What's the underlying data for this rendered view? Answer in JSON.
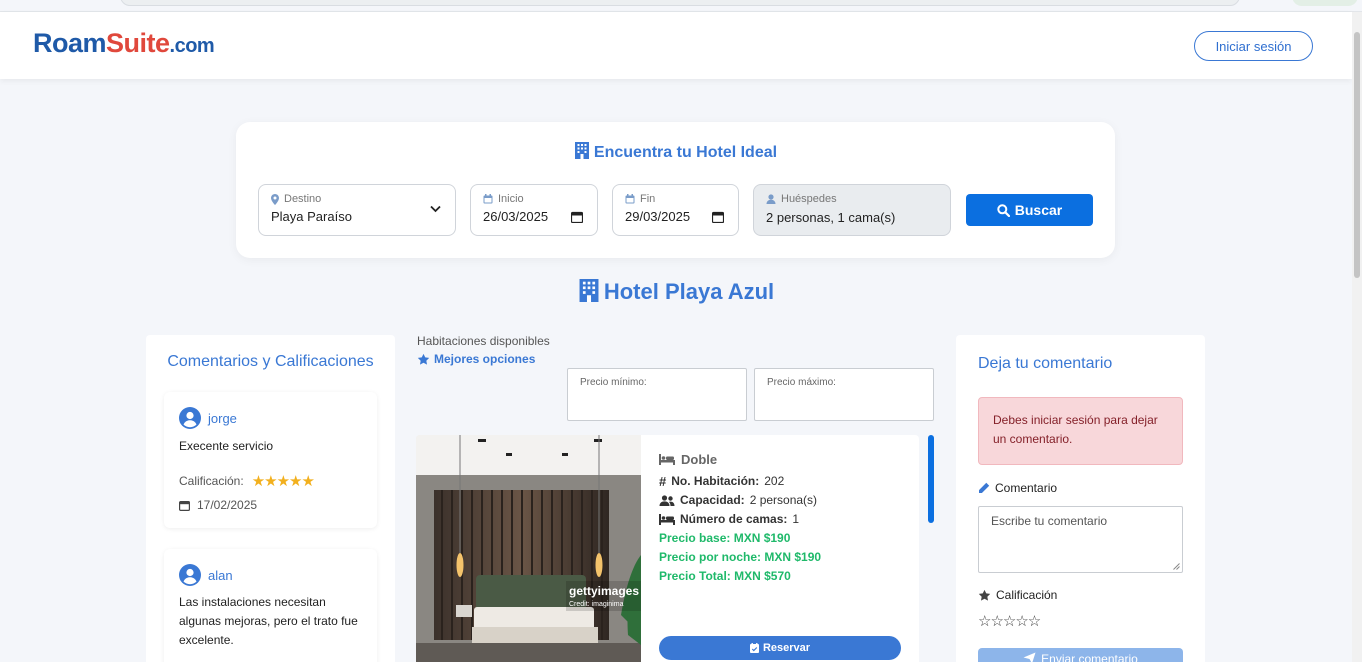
{
  "brand": {
    "part1": "Roam",
    "part2": "Suite",
    "part3": ".com"
  },
  "nav": {
    "login_label": "Iniciar sesión"
  },
  "search": {
    "title": "Encuentra tu Hotel Ideal",
    "destination": {
      "label": "Destino",
      "value": "Playa Paraíso"
    },
    "start": {
      "label": "Inicio",
      "value": "26/03/2025"
    },
    "end": {
      "label": "Fin",
      "value": "29/03/2025"
    },
    "guests": {
      "label": "Huéspedes",
      "value": "2 personas, 1 cama(s)"
    },
    "button_label": "Buscar"
  },
  "hotel": {
    "name": "Hotel Playa Azul"
  },
  "comments": {
    "title": "Comentarios y Calificaciones",
    "rating_label": "Calificación:",
    "items": [
      {
        "user": "jorge",
        "text": "Execente servicio",
        "stars": "★★★★★",
        "rating": 5,
        "date": "17/02/2025"
      },
      {
        "user": "alan",
        "text": "Las instalaciones necesitan algunas mejoras, pero el trato fue excelente."
      }
    ]
  },
  "rooms": {
    "heading": "Habitaciones disponibles",
    "best_label": "Mejores opciones",
    "min_price_label": "Precio mínimo:",
    "max_price_label": "Precio máximo:",
    "room": {
      "type": "Doble",
      "number_label": "No. Habitación:",
      "number": "202",
      "capacity_label": "Capacidad:",
      "capacity": "2 persona(s)",
      "beds_label": "Número de camas:",
      "beds": "1",
      "base_price": "Precio base: MXN $190",
      "night_price": "Precio por noche: MXN $190",
      "total_price": "Precio Total: MXN $570",
      "reserve_label": "Reservar",
      "watermark": "gettyimages",
      "credit": "Credit: imaginima"
    }
  },
  "review": {
    "title": "Deja tu comentario",
    "alert": "Debes iniciar sesión para dejar un comentario.",
    "comment_label": "Comentario",
    "comment_placeholder": "Escribe tu comentario",
    "rating_label": "Calificación",
    "empty_stars": "☆☆☆☆☆",
    "send_label": "Enviar comentario"
  },
  "colors": {
    "primary": "#3a78d4",
    "button": "#0b6fe0",
    "price_green": "#1fb96a",
    "alert_bg": "#f8d7da",
    "logo_blue": "#1f5aa8",
    "logo_red": "#e0483c"
  }
}
